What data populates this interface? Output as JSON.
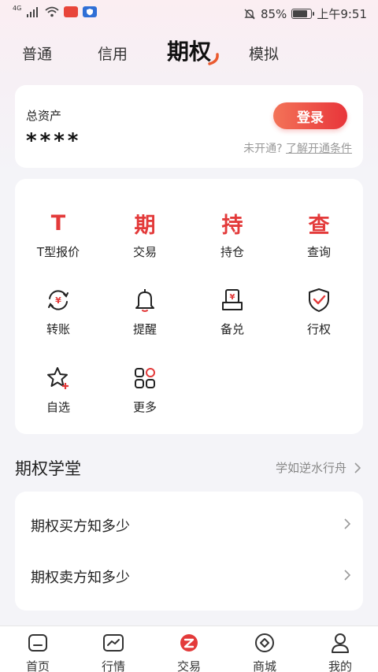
{
  "status_bar": {
    "network": "4G",
    "battery": "85%",
    "time": "上午9:51",
    "battery_level": 0.85
  },
  "tabs": [
    {
      "label": "普通"
    },
    {
      "label": "信用"
    },
    {
      "label": "期权",
      "active": true
    },
    {
      "label": "模拟"
    }
  ],
  "asset": {
    "label": "总资产",
    "value": "****",
    "login_label": "登录",
    "not_open": "未开通?",
    "conditions_link": "了解开通条件"
  },
  "grid": [
    {
      "glyph": "T",
      "label": "T型报价",
      "icon": "t-quote-icon"
    },
    {
      "glyph": "期",
      "label": "交易",
      "icon": "trade-icon"
    },
    {
      "glyph": "持",
      "label": "持仓",
      "icon": "position-icon"
    },
    {
      "glyph": "查",
      "label": "查询",
      "icon": "query-icon"
    },
    {
      "label": "转账",
      "icon": "transfer-icon"
    },
    {
      "label": "提醒",
      "icon": "bell-icon"
    },
    {
      "label": "备兑",
      "icon": "covered-icon"
    },
    {
      "label": "行权",
      "icon": "exercise-shield-icon"
    },
    {
      "label": "自选",
      "icon": "star-add-icon"
    },
    {
      "label": "更多",
      "icon": "more-grid-icon"
    }
  ],
  "section": {
    "title": "期权学堂",
    "more": "学如逆水行舟"
  },
  "lessons": [
    {
      "label": "期权买方知多少"
    },
    {
      "label": "期权卖方知多少"
    }
  ],
  "bottom_nav": [
    {
      "label": "首页",
      "icon": "home-icon"
    },
    {
      "label": "行情",
      "icon": "market-icon"
    },
    {
      "label": "交易",
      "icon": "trade-logo-icon",
      "active": true
    },
    {
      "label": "商城",
      "icon": "mall-icon"
    },
    {
      "label": "我的",
      "icon": "profile-icon"
    }
  ],
  "colors": {
    "accent": "#e33a3a",
    "login_gradient_start": "#f37358",
    "login_gradient_end": "#e8353a"
  }
}
